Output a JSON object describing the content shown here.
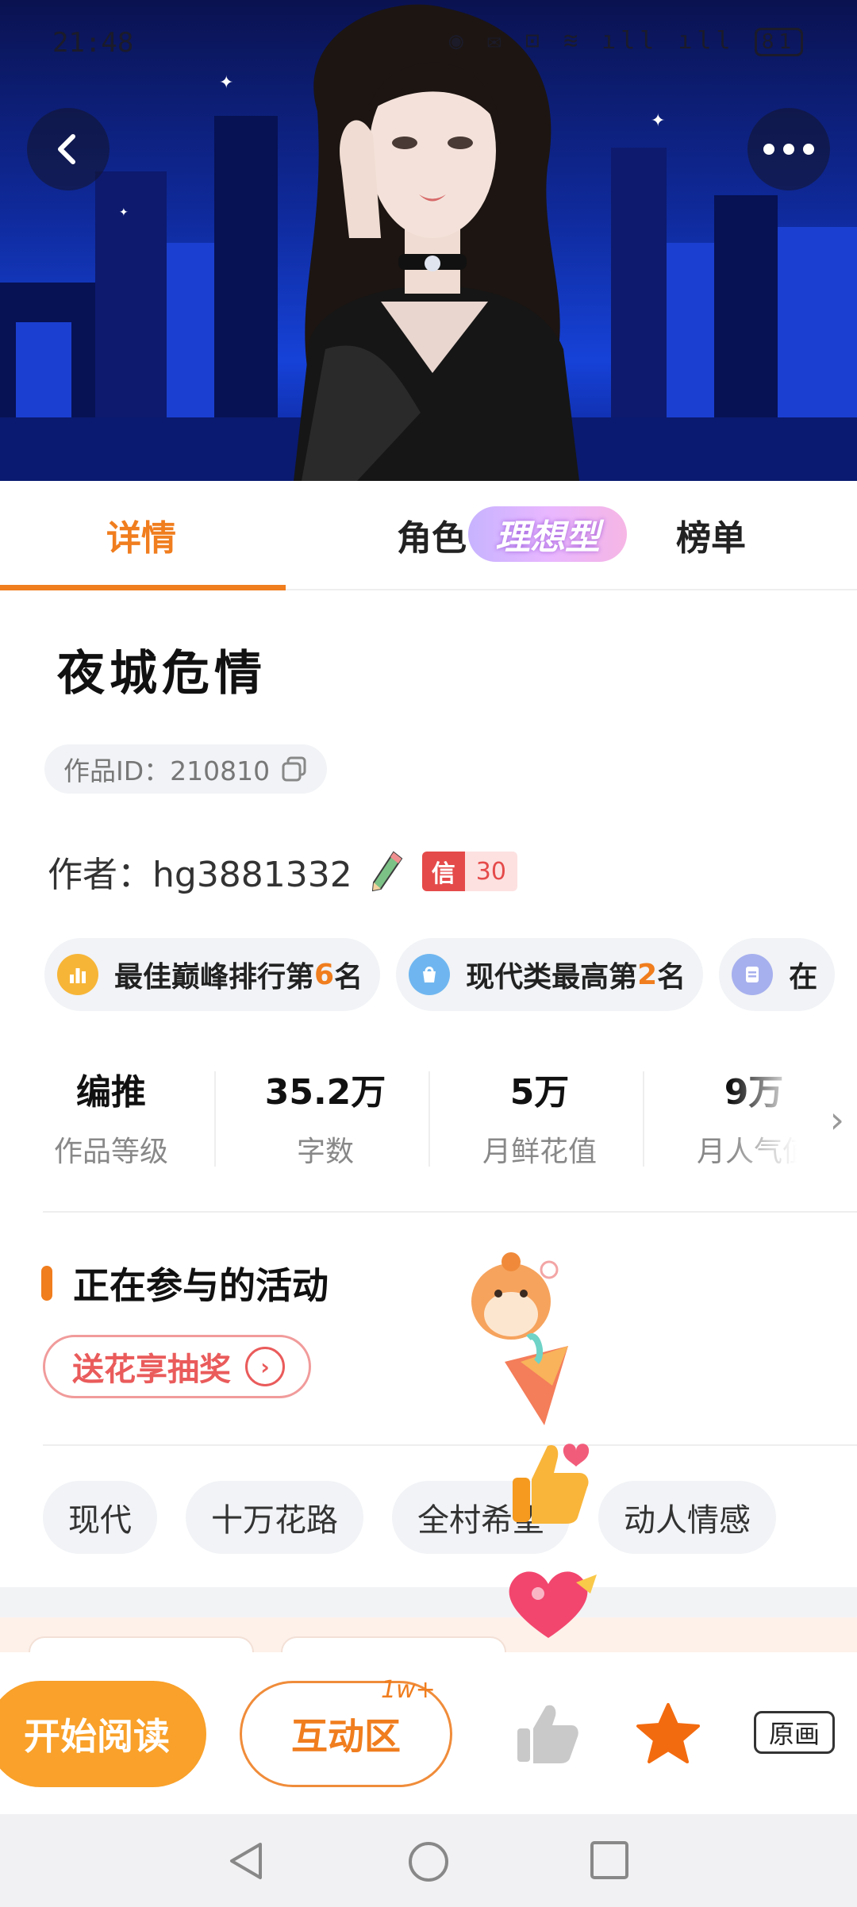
{
  "status_bar": {
    "time": "21:48",
    "icons": "◉ ✉ ⊡ ≋ ıll ıll",
    "battery": "81"
  },
  "tabs": [
    {
      "label": "详情"
    },
    {
      "label": "角色"
    },
    {
      "label": "榜单"
    }
  ],
  "ideal_badge": "理想型",
  "book": {
    "title": "夜城危情",
    "id_label": "作品ID：210810",
    "author_label": "作者：hg3881332",
    "credit_badge": {
      "a": "信",
      "b": "30"
    }
  },
  "rankings": [
    {
      "pre": "最佳巅峰排行第",
      "num": "6",
      "post": "名",
      "icon": "rank-bar-icon",
      "color": "#f7b537"
    },
    {
      "pre": "现代类最高第",
      "num": "2",
      "post": "名",
      "icon": "rank-bag-icon",
      "color": "#6fb6f0"
    },
    {
      "pre": "在",
      "num": "",
      "post": "",
      "icon": "rank-doc-icon",
      "color": "#a7b0ee"
    }
  ],
  "stats": [
    {
      "value": "编推",
      "label": "作品等级"
    },
    {
      "value": "35.2万",
      "label": "字数"
    },
    {
      "value": "5万",
      "label": "月鲜花值"
    },
    {
      "value": "9万",
      "label": "月人气值"
    }
  ],
  "activities": {
    "title": "正在参与的活动",
    "pill": "送花享抽奖"
  },
  "tags": [
    "现代",
    "十万花路",
    "全村希望",
    "动人情感"
  ],
  "bottom_bar": {
    "read_label": "开始阅读",
    "interact_label": "互动区",
    "interact_count": "1w+",
    "original_label": "原画"
  },
  "colors": {
    "accent": "#f07d1e",
    "read_button": "#f9a12a",
    "credit_red": "#e54a4a"
  }
}
